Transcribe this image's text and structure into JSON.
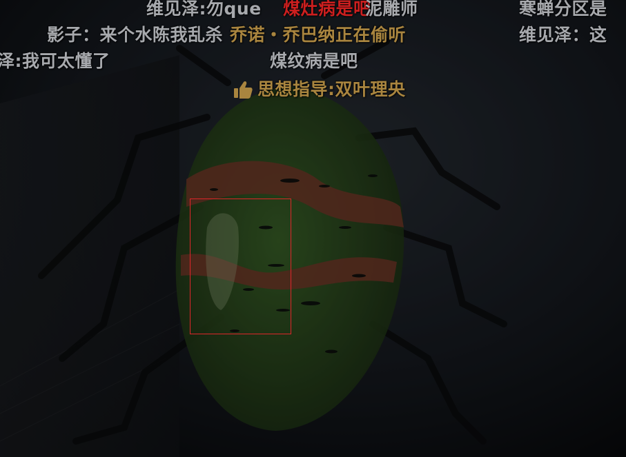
{
  "danmaku": [
    {
      "id": "d1",
      "text": "维见泽:勿que",
      "color": "grey"
    },
    {
      "id": "d2",
      "text": "煤灶病是吧",
      "color": "red"
    },
    {
      "id": "d3",
      "text": "泥雕师",
      "color": "grey"
    },
    {
      "id": "d4",
      "text": "寒蝉分区是",
      "color": "grey"
    },
    {
      "id": "d5",
      "text": "影子：来个水陈我乱杀",
      "color": "grey"
    },
    {
      "id": "d6",
      "text": "乔诺・乔巴纳正在偷听",
      "color": "gold"
    },
    {
      "id": "d7",
      "text": "维见泽：这",
      "color": "grey"
    },
    {
      "id": "d8",
      "text": "泽:我可太懂了",
      "color": "grey"
    },
    {
      "id": "d9",
      "text": "煤纹病是吧",
      "color": "grey"
    },
    {
      "id": "d10",
      "text": "思想指导:双叶理央",
      "color": "gold",
      "icon": "thumbs-up-icon"
    }
  ],
  "colors": {
    "grey_text": "#a7a9ad",
    "red_text": "#cc1f1f",
    "gold_text": "#a9853f",
    "focus_box": "#e0262a",
    "bug_green": "#4d7a2e",
    "bug_red": "#8a3a2c"
  }
}
